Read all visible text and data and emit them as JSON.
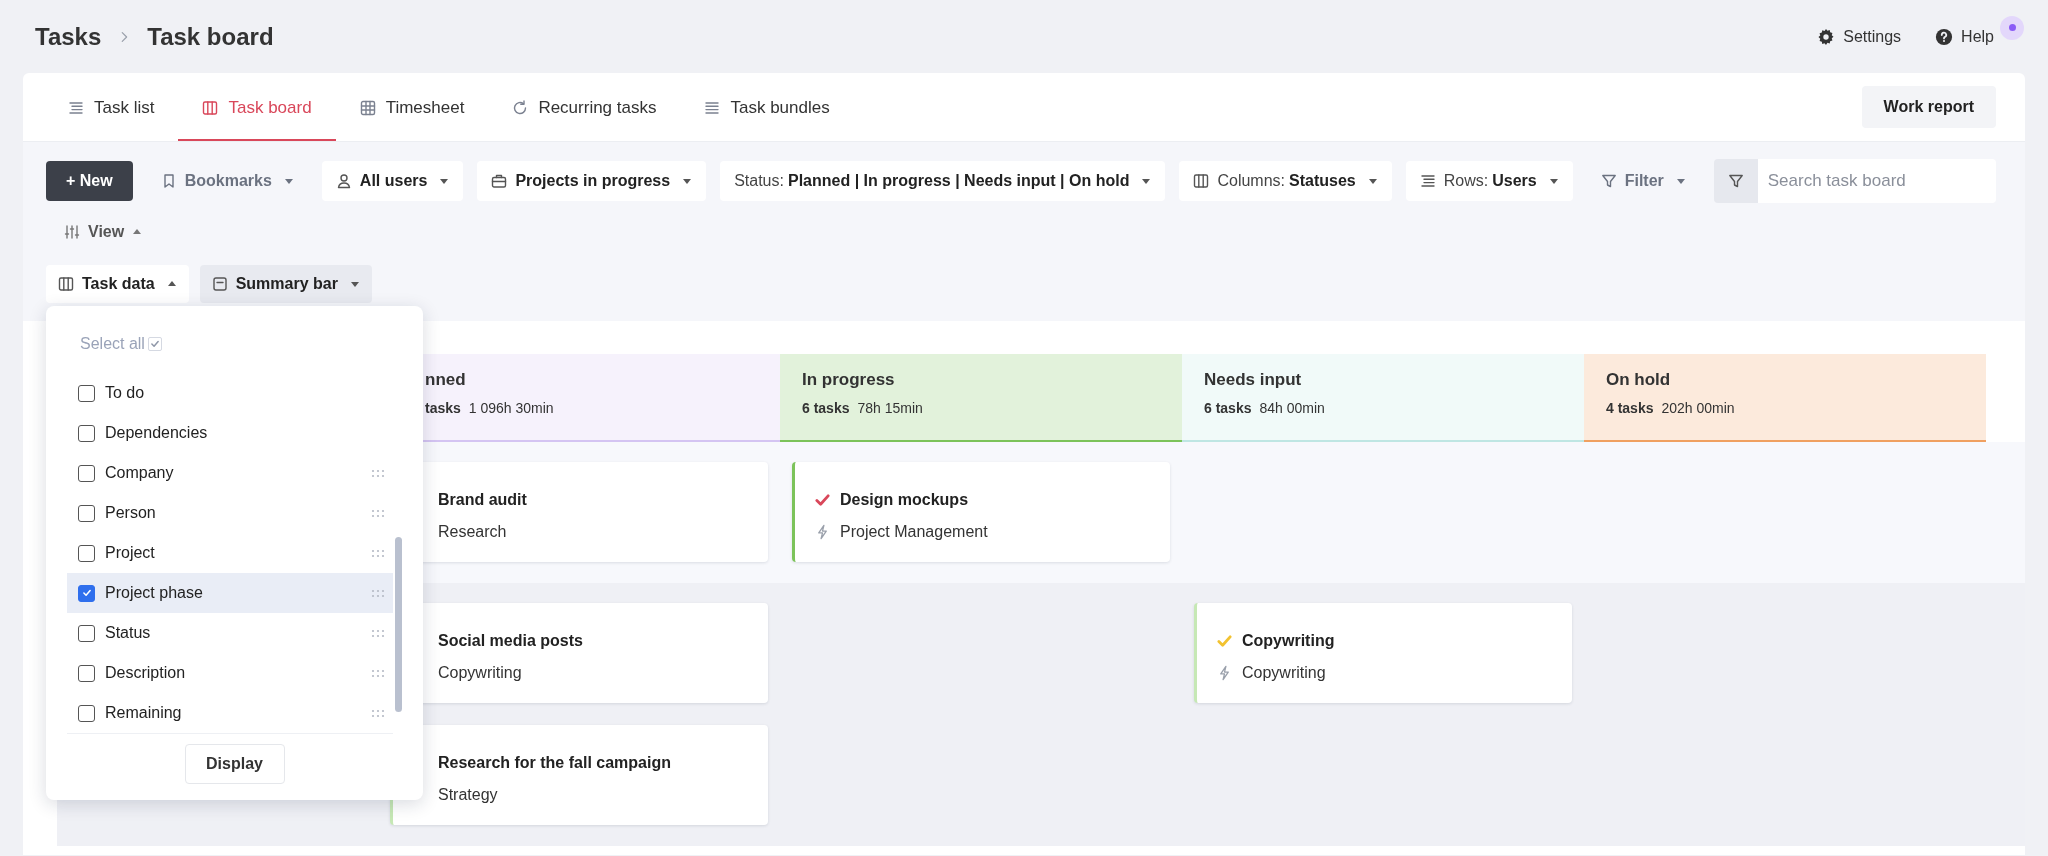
{
  "breadcrumb": [
    {
      "label": "Tasks"
    },
    {
      "label": "Task board"
    }
  ],
  "header_actions": [
    {
      "label": "Settings",
      "notification": false
    },
    {
      "label": "Help",
      "notification": true
    }
  ],
  "tabs": [
    {
      "label": "Task list",
      "selected": false
    },
    {
      "label": "Task board",
      "selected": true
    },
    {
      "label": "Timesheet",
      "selected": false
    },
    {
      "label": "Recurring tasks",
      "selected": false
    },
    {
      "label": "Task bundles",
      "selected": false
    }
  ],
  "work_report": "Work report",
  "toolbar": [
    {
      "kind": "primary",
      "label": "+ New"
    },
    {
      "kind": "ghost",
      "label": "Bookmarks"
    },
    {
      "kind": "chip",
      "label": "All users"
    },
    {
      "kind": "chip",
      "label": "Projects in progress"
    },
    {
      "kind": "chip",
      "prefix": "Status:",
      "label": "Planned | In progress | Needs input | On hold"
    },
    {
      "kind": "chip",
      "prefix": "Columns:",
      "label": "Statuses"
    },
    {
      "kind": "chip",
      "prefix": "Rows:",
      "label": "Users"
    },
    {
      "kind": "ghost",
      "label": "Filter"
    },
    {
      "kind": "search",
      "placeholder": "Search task board"
    }
  ],
  "view_toggle": {
    "label": "View",
    "expanded": true
  },
  "view_options": [
    {
      "label": "Task data",
      "open": true
    },
    {
      "label": "Summary bar",
      "open": false
    }
  ],
  "column_picker": {
    "select_all": {
      "label": "Select all",
      "checked": true
    },
    "fields": [
      {
        "label": "To do",
        "checked": false,
        "draggable": false,
        "hovered": false
      },
      {
        "label": "Dependencies",
        "checked": false,
        "draggable": false,
        "hovered": false
      },
      {
        "label": "Company",
        "checked": false,
        "draggable": true,
        "hovered": false
      },
      {
        "label": "Person",
        "checked": false,
        "draggable": true,
        "hovered": false
      },
      {
        "label": "Project",
        "checked": false,
        "draggable": true,
        "hovered": false
      },
      {
        "label": "Project phase",
        "checked": true,
        "draggable": true,
        "hovered": true
      },
      {
        "label": "Status",
        "checked": false,
        "draggable": true,
        "hovered": false
      },
      {
        "label": "Description",
        "checked": false,
        "draggable": true,
        "hovered": false
      },
      {
        "label": "Remaining",
        "checked": false,
        "draggable": true,
        "hovered": false
      }
    ],
    "button": "Display"
  },
  "board": {
    "columns": [
      {
        "title": "nned",
        "count": "tasks",
        "duration": "1 096h 30min",
        "color": "#d4c4f2"
      },
      {
        "title": "In progress",
        "count": "6 tasks",
        "duration": "78h 15min",
        "color": "#7cc35a"
      },
      {
        "title": "Needs input",
        "count": "6 tasks",
        "duration": "84h 00min",
        "color": "#bfe6e3"
      },
      {
        "title": "On hold",
        "count": "4 tasks",
        "duration": "202h 00min",
        "color": "#f0a060"
      }
    ],
    "rows": [
      {
        "cells": [
          [
            {
              "title": "Brand audit",
              "phase": "Research",
              "bolt": false
            }
          ],
          [
            {
              "title": "Design mockups",
              "phase": "Project Management",
              "color": "#7cc35a",
              "check": {
                "color": "#d9475a"
              },
              "bolt": true
            }
          ],
          [],
          []
        ]
      },
      {
        "cells": [
          [
            {
              "title": "Social media posts",
              "phase": "Copywriting",
              "bolt": false
            },
            {
              "title": "Research for the fall campaign",
              "phase": "Strategy",
              "color": "#c6e8b5",
              "bolt": false
            }
          ],
          [],
          [
            {
              "title": "Copywriting",
              "phase": "Copywriting",
              "color": "#c6e8b5",
              "check": {
                "color": "#f2c230"
              },
              "bolt": true
            }
          ],
          []
        ]
      }
    ]
  }
}
